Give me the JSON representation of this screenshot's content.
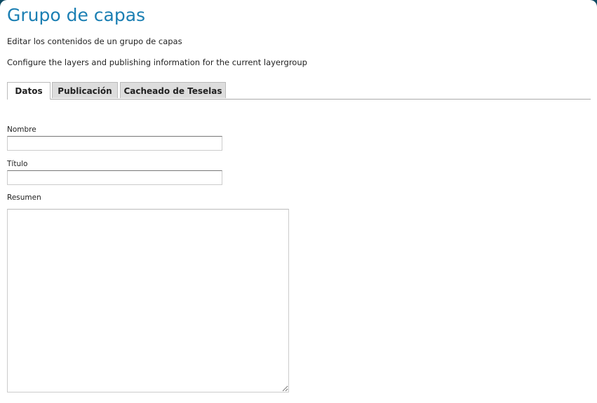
{
  "header": {
    "title": "Grupo de capas",
    "subtitle": "Editar los contenidos de un grupo de capas",
    "description": "Configure the layers and publishing information for the current layergroup"
  },
  "tabs": [
    {
      "label": "Datos",
      "active": true
    },
    {
      "label": "Publicación",
      "active": false
    },
    {
      "label": "Cacheado de Teselas",
      "active": false
    }
  ],
  "form": {
    "nombre": {
      "label": "Nombre",
      "value": ""
    },
    "titulo": {
      "label": "Título",
      "value": ""
    },
    "resumen": {
      "label": "Resumen",
      "value": ""
    }
  },
  "colors": {
    "title": "#1b7fb3"
  }
}
